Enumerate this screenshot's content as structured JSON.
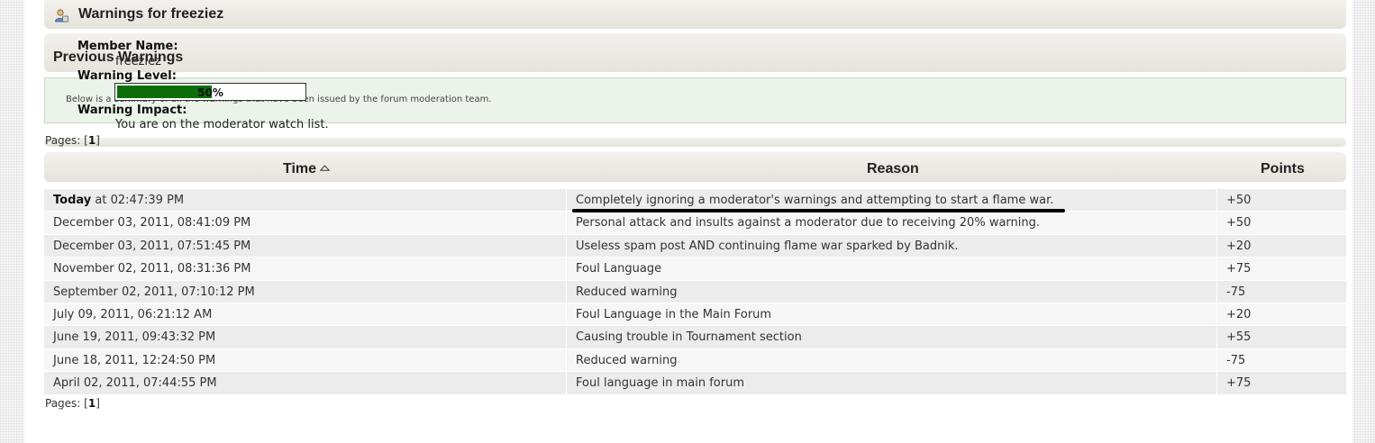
{
  "header": {
    "title": "Warnings for freeziez",
    "icon": "user-icon"
  },
  "member": {
    "name_label": "Member Name:",
    "name_value": "freeziez",
    "level_label": "Warning Level:",
    "level_percent": 50,
    "level_text": "50%",
    "impact_label": "Warning Impact:",
    "impact_value": "You are on the moderator watch list."
  },
  "previous": {
    "title": "Previous Warnings",
    "info": "Below is a summary of all the warnings that have been issued by the forum moderation team."
  },
  "pagination": {
    "label": "Pages: [",
    "current": "1",
    "close": "]"
  },
  "table": {
    "headers": {
      "time": "Time",
      "reason": "Reason",
      "points": "Points"
    },
    "sort_icon": "sort-ascending-icon",
    "rows": [
      {
        "time_bold": "Today",
        "time": " at 02:47:39 PM",
        "reason": "Completely ignoring a moderator's warnings and attempting to start a flame war.",
        "points": "+50"
      },
      {
        "time_bold": "",
        "time": "December 03, 2011, 08:41:09 PM",
        "reason": "Personal attack and insults against a moderator due to receiving 20% warning.",
        "points": "+50"
      },
      {
        "time_bold": "",
        "time": "December 03, 2011, 07:51:45 PM",
        "reason": "Useless spam post AND continuing flame war sparked by Badnik.",
        "points": "+20"
      },
      {
        "time_bold": "",
        "time": "November 02, 2011, 08:31:36 PM",
        "reason": "Foul Language",
        "points": "+75"
      },
      {
        "time_bold": "",
        "time": "September 02, 2011, 07:10:12 PM",
        "reason": "Reduced warning",
        "points": "-75"
      },
      {
        "time_bold": "",
        "time": "July 09, 2011, 06:21:12 AM",
        "reason": "Foul Language in the Main Forum",
        "points": "+20"
      },
      {
        "time_bold": "",
        "time": "June 19, 2011, 09:43:32 PM",
        "reason": "Causing trouble in Tournament section",
        "points": "+55"
      },
      {
        "time_bold": "",
        "time": "June 18, 2011, 12:24:50 PM",
        "reason": "Reduced warning",
        "points": "-75"
      },
      {
        "time_bold": "",
        "time": "April 02, 2011, 07:44:55 PM",
        "reason": "Foul language in main forum",
        "points": "+75"
      }
    ]
  },
  "colors": {
    "progress_fill": "#0b6e0b",
    "info_background": "#ecf3ea",
    "header_bar": "#e6e3dc"
  }
}
